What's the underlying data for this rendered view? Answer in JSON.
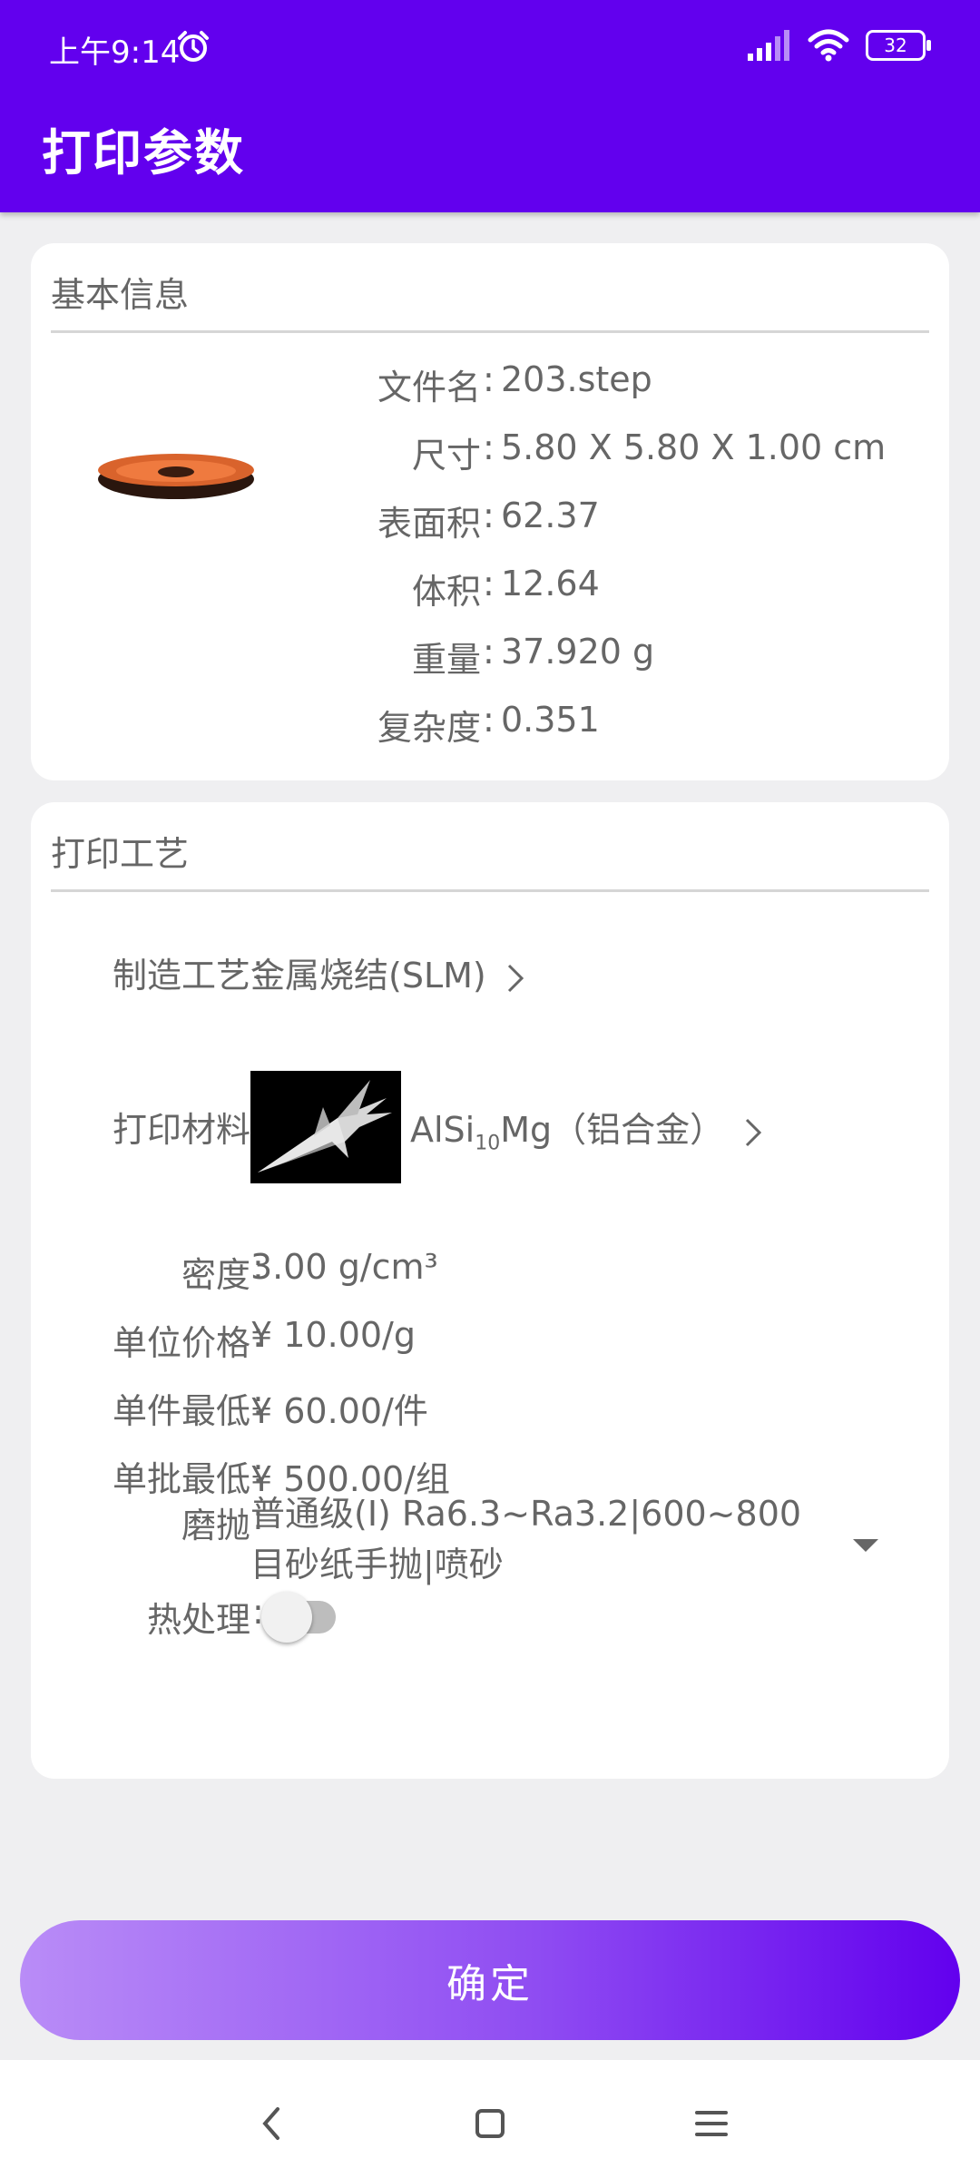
{
  "status_bar": {
    "time": "上午9:14",
    "battery": "32"
  },
  "header": {
    "title": "打印参数"
  },
  "basic_info": {
    "title": "基本信息",
    "rows": [
      {
        "label": "文件名",
        "value": "203.step"
      },
      {
        "label": "尺寸",
        "value": "5.80 X 5.80 X 1.00 cm"
      },
      {
        "label": "表面积",
        "value": "62.37"
      },
      {
        "label": "体积",
        "value": "12.64"
      },
      {
        "label": "重量",
        "value": "37.920 g"
      },
      {
        "label": "复杂度",
        "value": "0.351"
      }
    ]
  },
  "print_process": {
    "title": "打印工艺",
    "process": {
      "label": "制造工艺",
      "value": "金属烧结(SLM)"
    },
    "material": {
      "label": "打印材料",
      "name_prefix": "AlSi",
      "name_sub": "10",
      "name_suffix": "Mg（铝合金）"
    },
    "density": {
      "label": "密度",
      "value": "3.00 g/cm³"
    },
    "unit_price": {
      "label": "单位价格",
      "value": "¥ 10.00/g"
    },
    "min_piece": {
      "label": "单件最低",
      "value": "¥ 60.00/件"
    },
    "min_batch": {
      "label": "单批最低",
      "value": "¥ 500.00/组"
    },
    "polish": {
      "label": "磨抛",
      "value": "普通级(I)  Ra6.3~Ra3.2|600~800目砂纸手抛|喷砂"
    },
    "heat_treatment": {
      "label": "热处理",
      "enabled": false
    }
  },
  "confirm_label": "确定",
  "colors": {
    "primary": "#6200ee",
    "card": "#ffffff",
    "background": "#efeff1"
  },
  "icons": [
    "alarm-icon",
    "signal-icon",
    "wifi-icon",
    "battery-icon",
    "chevron-right-icon",
    "dropdown-arrow-icon",
    "back-icon",
    "home-icon",
    "menu-icon"
  ]
}
